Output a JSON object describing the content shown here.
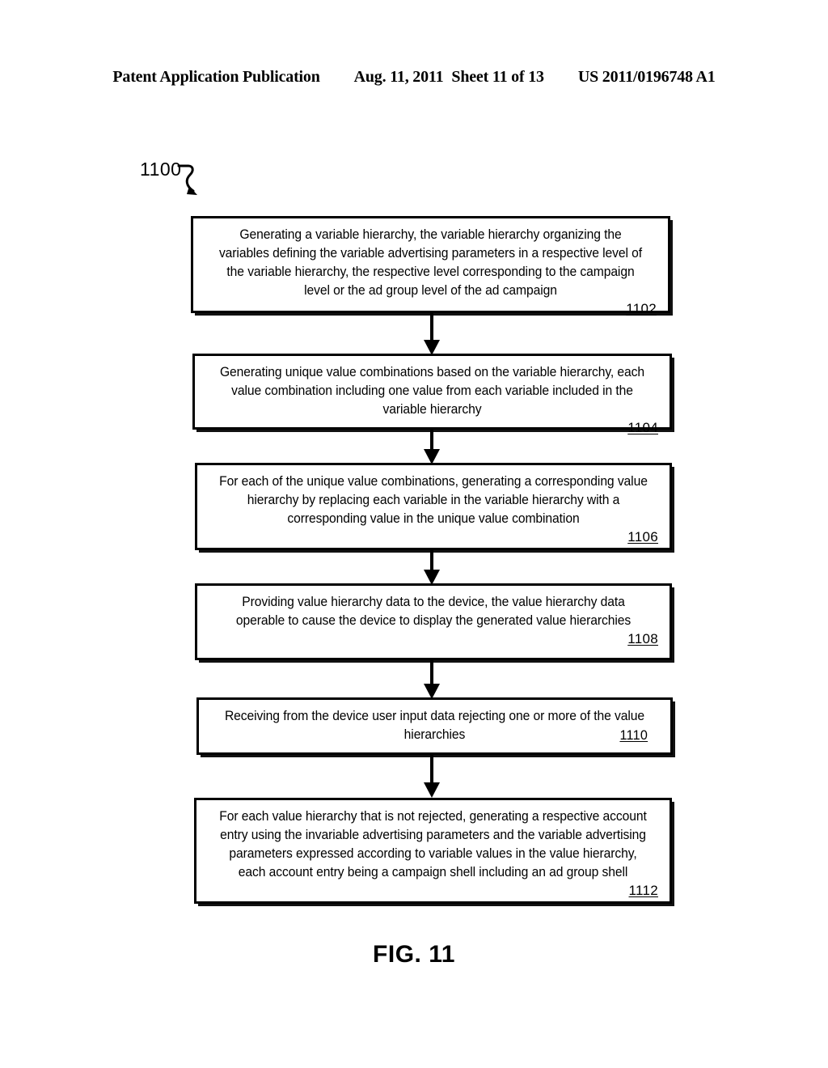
{
  "header": {
    "publication": "Patent Application Publication",
    "date": "Aug. 11, 2011",
    "sheet": "Sheet 11 of 13",
    "publication_number": "US 2011/0196748 A1"
  },
  "figure": {
    "flow_label": "1100",
    "caption": "FIG. 11",
    "steps": [
      {
        "ref": "1102",
        "ref_inline": false,
        "text": "Generating a variable hierarchy, the variable hierarchy organizing the variables defining the variable advertising parameters in a respective level of the variable hierarchy, the respective level corresponding to the campaign level or the ad group level of the ad campaign"
      },
      {
        "ref": "1104",
        "ref_inline": false,
        "text": "Generating unique value combinations based on the variable hierarchy, each value combination including one value from each variable included in the variable hierarchy"
      },
      {
        "ref": "1106",
        "ref_inline": false,
        "text": "For each of the unique value combinations, generating a corresponding value hierarchy by replacing each variable in the variable hierarchy with a corresponding value in the unique value combination"
      },
      {
        "ref": "1108",
        "ref_inline": false,
        "text": "Providing value hierarchy data to the device, the value hierarchy data operable to cause the device to display the generated value hierarchies"
      },
      {
        "ref": "1110",
        "ref_inline": true,
        "text": "Receiving from the device user input data rejecting one or more of the value hierarchies"
      },
      {
        "ref": "1112",
        "ref_inline": false,
        "text": "For each value hierarchy that is not rejected, generating a respective account entry using the invariable advertising parameters and the variable advertising parameters expressed according to variable values in the value hierarchy, each account entry being a campaign shell including an ad group shell"
      }
    ]
  },
  "colors": {
    "ink": "#000000",
    "paper": "#ffffff"
  }
}
